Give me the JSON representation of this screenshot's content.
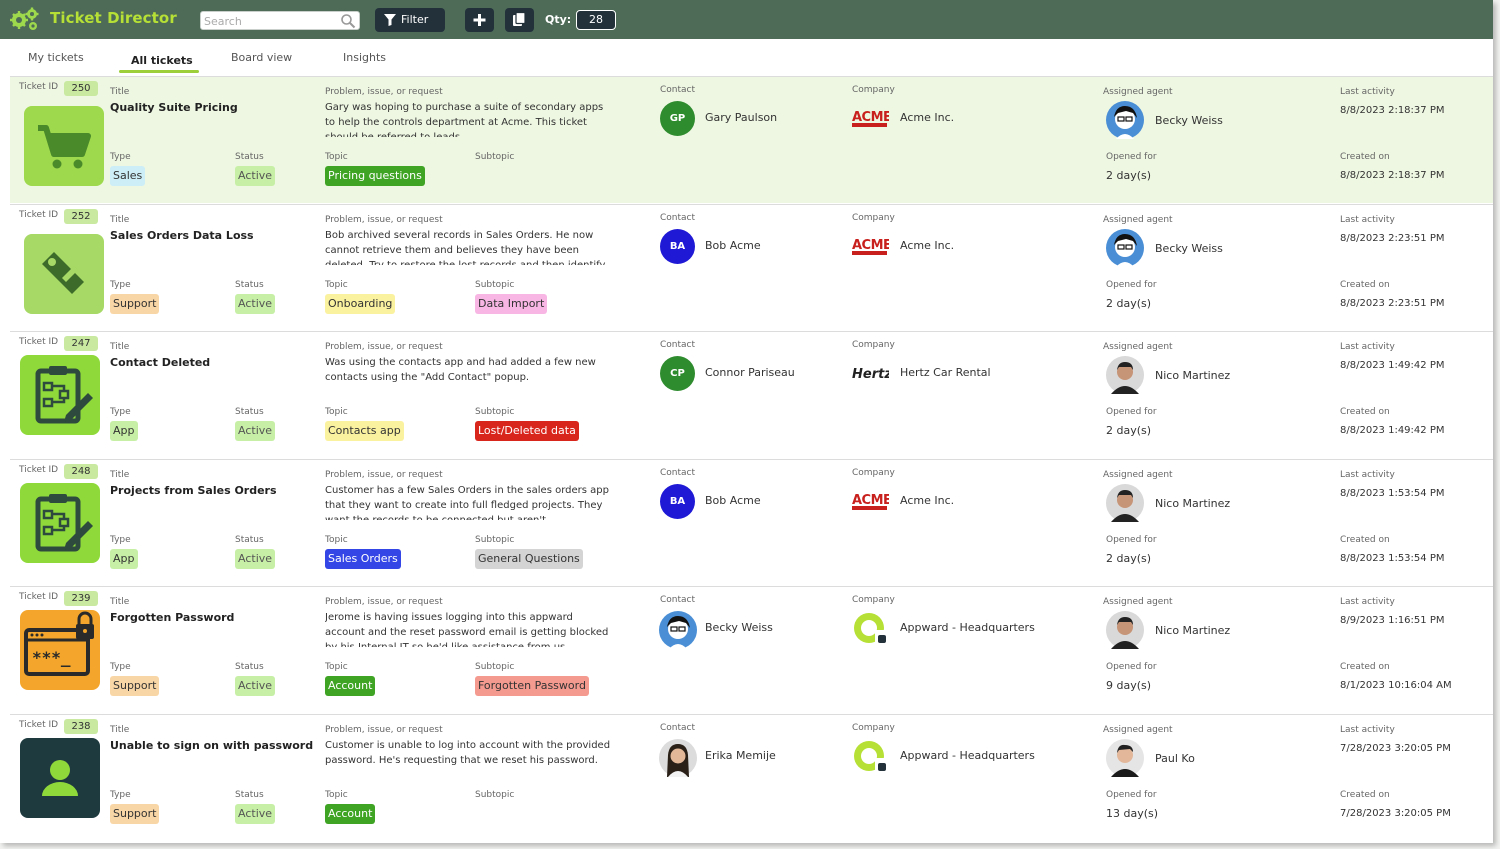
{
  "app": {
    "title": "Ticket Director"
  },
  "toolbar": {
    "search_placeholder": "Search",
    "filter_label": "Filter",
    "qty_label": "Qty:",
    "qty_value": "28"
  },
  "tabs": [
    {
      "label": "My tickets",
      "active": false
    },
    {
      "label": "All tickets",
      "active": true
    },
    {
      "label": "Board view",
      "active": false
    },
    {
      "label": "Insights",
      "active": false
    }
  ],
  "labels": {
    "ticket_id": "Ticket ID",
    "title": "Title",
    "problem": "Problem, issue, or request",
    "contact": "Contact",
    "company": "Company",
    "assigned": "Assigned agent",
    "last_activity": "Last activity",
    "type": "Type",
    "status": "Status",
    "topic": "Topic",
    "subtopic": "Subtopic",
    "opened_for": "Opened for",
    "created_on": "Created on"
  },
  "tickets": [
    {
      "id": "250",
      "icon": "cart-icon",
      "icon_bg": "#9ed94d",
      "icon_fg": "#4a8a2a",
      "title": "Quality Suite Pricing",
      "problem": "Gary was hoping to purchase a suite of secondary apps to help the controls department at Acme. This ticket should be referred to leads",
      "type": "Sales",
      "type_bg": "#cdeef6",
      "status": "Active",
      "topic": "Pricing questions",
      "topic_bg": "#3fa324",
      "topic_fg": "#ffffff",
      "subtopic": "",
      "subtopic_bg": "",
      "subtopic_fg": "",
      "contact": "Gary Paulson",
      "contact_initials": "GP",
      "contact_bg": "#2e8b2e",
      "contact_photo": "",
      "company": "Acme Inc.",
      "company_logo": "acme",
      "agent": "Becky Weiss",
      "agent_photo": "becky",
      "last_activity": "8/8/2023 2:18:37 PM",
      "opened_for": "2 day(s)",
      "created_on": "8/8/2023 2:18:37 PM"
    },
    {
      "id": "252",
      "icon": "wrench-tag-icon",
      "icon_bg": "#a6d965",
      "icon_fg": "#3d6b2a",
      "title": "Sales Orders Data Loss",
      "problem": "Bob archived several records in Sales Orders. He now cannot retrieve them and believes they have been deleted. Try to restore the lost records and then identify",
      "type": "Support",
      "type_bg": "#f9d6a6",
      "status": "Active",
      "topic": "Onboarding",
      "topic_bg": "#fbf2a0",
      "topic_fg": "#333333",
      "subtopic": "Data Import",
      "subtopic_bg": "#f7b6e3",
      "subtopic_fg": "#333333",
      "contact": "Bob Acme",
      "contact_initials": "BA",
      "contact_bg": "#1f19d6",
      "contact_photo": "",
      "company": "Acme Inc.",
      "company_logo": "acme",
      "agent": "Becky Weiss",
      "agent_photo": "becky",
      "last_activity": "8/8/2023 2:23:51 PM",
      "opened_for": "2 day(s)",
      "created_on": "8/8/2023 2:23:51 PM"
    },
    {
      "id": "247",
      "icon": "clipboard-edit-icon",
      "icon_bg": "#8fd93a",
      "icon_fg": "#2e4a3e",
      "title": "Contact Deleted",
      "problem": "Was using the contacts app and had added a few new contacts using the \"Add Contact\" popup.",
      "type": "App",
      "type_bg": "#c7f0a6",
      "status": "Active",
      "topic": "Contacts app",
      "topic_bg": "#fbf2a0",
      "topic_fg": "#333333",
      "subtopic": "Lost/Deleted data",
      "subtopic_bg": "#d9261c",
      "subtopic_fg": "#ffffff",
      "contact": "Connor Pariseau",
      "contact_initials": "CP",
      "contact_bg": "#2e8b2e",
      "contact_photo": "",
      "company": "Hertz Car Rental",
      "company_logo": "hertz",
      "agent": "Nico Martinez",
      "agent_photo": "nico",
      "last_activity": "8/8/2023 1:49:42 PM",
      "opened_for": "2 day(s)",
      "created_on": "8/8/2023 1:49:42 PM"
    },
    {
      "id": "248",
      "icon": "clipboard-edit-icon",
      "icon_bg": "#8fd93a",
      "icon_fg": "#2e4a3e",
      "title": "Projects from Sales Orders",
      "problem": "Customer has a few Sales Orders in the sales orders app that they want to create into full fledged projects. They want the records to be connected but aren't",
      "type": "App",
      "type_bg": "#c7f0a6",
      "status": "Active",
      "topic": "Sales Orders",
      "topic_bg": "#3446e6",
      "topic_fg": "#ffffff",
      "subtopic": "General Questions",
      "subtopic_bg": "#d4d4d4",
      "subtopic_fg": "#333333",
      "contact": "Bob Acme",
      "contact_initials": "BA",
      "contact_bg": "#1f19d6",
      "contact_photo": "",
      "company": "Acme Inc.",
      "company_logo": "acme",
      "agent": "Nico Martinez",
      "agent_photo": "nico",
      "last_activity": "8/8/2023 1:53:54 PM",
      "opened_for": "2 day(s)",
      "created_on": "8/8/2023 1:53:54 PM"
    },
    {
      "id": "239",
      "icon": "password-lock-icon",
      "icon_bg": "#f3a62b",
      "icon_fg": "#2a2a2a",
      "title": "Forgotten Password",
      "problem": "Jerome is having issues logging into this appward account and the reset password email is getting blocked by his Internal IT so he'd like assistance from us",
      "type": "Support",
      "type_bg": "#f9d6a6",
      "status": "Active",
      "topic": "Account",
      "topic_bg": "#3fa324",
      "topic_fg": "#ffffff",
      "subtopic": "Forgotten Password",
      "subtopic_bg": "#f59a8f",
      "subtopic_fg": "#333333",
      "contact": "Becky Weiss",
      "contact_initials": "",
      "contact_bg": "",
      "contact_photo": "becky",
      "company": "Appward - Headquarters",
      "company_logo": "appward",
      "agent": "Nico Martinez",
      "agent_photo": "nico",
      "last_activity": "8/9/2023 1:16:51 PM",
      "opened_for": "9 day(s)",
      "created_on": "8/1/2023 10:16:04 AM"
    },
    {
      "id": "238",
      "icon": "user-account-icon",
      "icon_bg": "#1e3a3f",
      "icon_fg": "#8fd93a",
      "title": "Unable to sign on with password",
      "problem": "Customer is unable to log into account with the provided password. He's requesting that we reset his password.",
      "type": "Support",
      "type_bg": "#f9d6a6",
      "status": "Active",
      "topic": "Account",
      "topic_bg": "#3fa324",
      "topic_fg": "#ffffff",
      "subtopic": "",
      "subtopic_bg": "",
      "subtopic_fg": "",
      "contact": "Erika Memije",
      "contact_initials": "",
      "contact_bg": "",
      "contact_photo": "erika",
      "company": "Appward - Headquarters",
      "company_logo": "appward",
      "agent": "Paul Ko",
      "agent_photo": "paul",
      "last_activity": "7/28/2023 3:20:05 PM",
      "opened_for": "13 day(s)",
      "created_on": "7/28/2023 3:20:05 PM"
    }
  ]
}
